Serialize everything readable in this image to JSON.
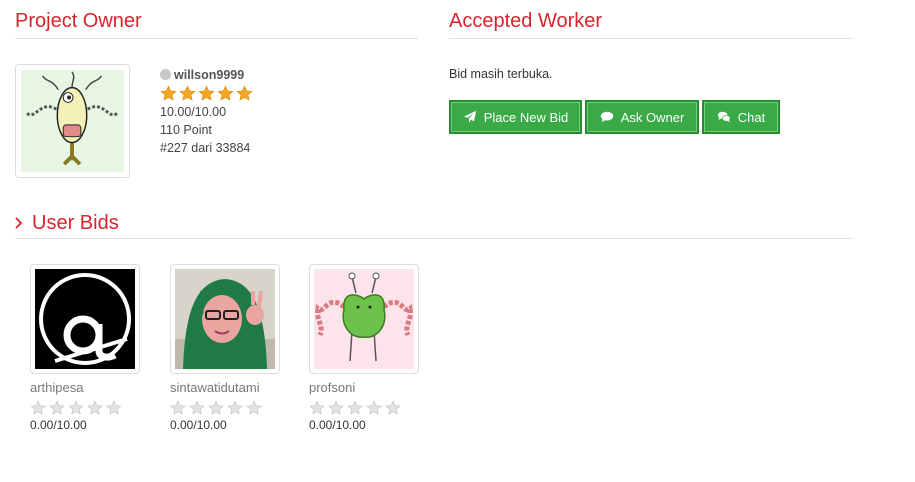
{
  "owner": {
    "title": "Project Owner",
    "username": "willson9999",
    "rating": "10.00/10.00",
    "stars": 5,
    "points": "110 Point",
    "rank": "#227 dari 33884"
  },
  "worker": {
    "title": "Accepted Worker",
    "status": "Bid masih terbuka.",
    "buttons": {
      "place_bid": "Place New Bid",
      "ask_owner": "Ask Owner",
      "chat": "Chat"
    }
  },
  "bids": {
    "title": "User Bids",
    "items": [
      {
        "name": "arthipesa",
        "score": "0.00/10.00",
        "stars": 0
      },
      {
        "name": "sintawatidutami",
        "score": "0.00/10.00",
        "stars": 0
      },
      {
        "name": "profsoni",
        "score": "0.00/10.00",
        "stars": 0
      }
    ]
  },
  "colors": {
    "accent": "#d9232e",
    "button_green": "#3aaa46",
    "star_gold": "#f5a623",
    "star_empty": "#d0d0d0"
  }
}
